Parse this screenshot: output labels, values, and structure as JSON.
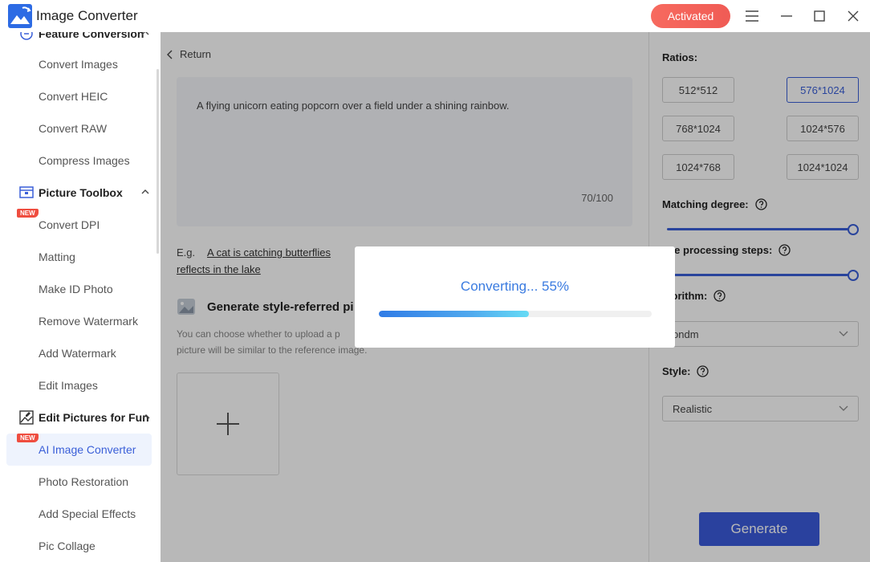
{
  "app": {
    "title": "Image Converter",
    "activated_label": "Activated"
  },
  "sidebar": {
    "groups": [
      {
        "label": "Feature Conversion"
      },
      {
        "label": "Picture Toolbox"
      },
      {
        "label": "Edit Pictures for Fun"
      }
    ],
    "items": [
      {
        "label": "Convert Images"
      },
      {
        "label": "Convert HEIC"
      },
      {
        "label": "Convert RAW"
      },
      {
        "label": "Compress Images"
      },
      {
        "label": "Convert DPI",
        "badge": "NEW"
      },
      {
        "label": "Matting"
      },
      {
        "label": "Make ID Photo"
      },
      {
        "label": "Remove Watermark"
      },
      {
        "label": "Add Watermark"
      },
      {
        "label": "Edit Images"
      },
      {
        "label": "AI Image Converter",
        "badge": "NEW",
        "active": true
      },
      {
        "label": "Photo Restoration"
      },
      {
        "label": "Add Special Effects"
      },
      {
        "label": "Pic Collage"
      }
    ]
  },
  "main": {
    "return_label": "Return",
    "prompt_text": "A flying unicorn eating popcorn over a field under a shining rainbow.",
    "char_count": "70/100",
    "example_label": "E.g.",
    "example_link_1": "A cat is catching butterflies",
    "example_link_2": "reflects in the lake",
    "style_ref_title": "Generate style-referred pi",
    "style_ref_desc_1": "You can choose whether to upload a p",
    "style_ref_desc_2": "picture will be similar to the reference image."
  },
  "right_panel": {
    "ratios_label": "Ratios:",
    "ratios": [
      "512*512",
      "576*1024",
      "768*1024",
      "1024*576",
      "1024*768",
      "1024*1024"
    ],
    "selected_ratio": "576*1024",
    "matching_label": "Matching degree:",
    "matching_value": 1.0,
    "steps_label": "age processing steps:",
    "steps_value": 1.0,
    "algorithm_label": "lgorithm:",
    "algorithm_value": "ondm",
    "style_label": "Style:",
    "style_value": "Realistic",
    "generate_label": "Generate"
  },
  "modal": {
    "title": "Converting... 55%",
    "progress": 0.55
  },
  "colors": {
    "accent": "#3a5fd8",
    "activated": "#f05b55",
    "new_badge": "#ef4d3f"
  }
}
